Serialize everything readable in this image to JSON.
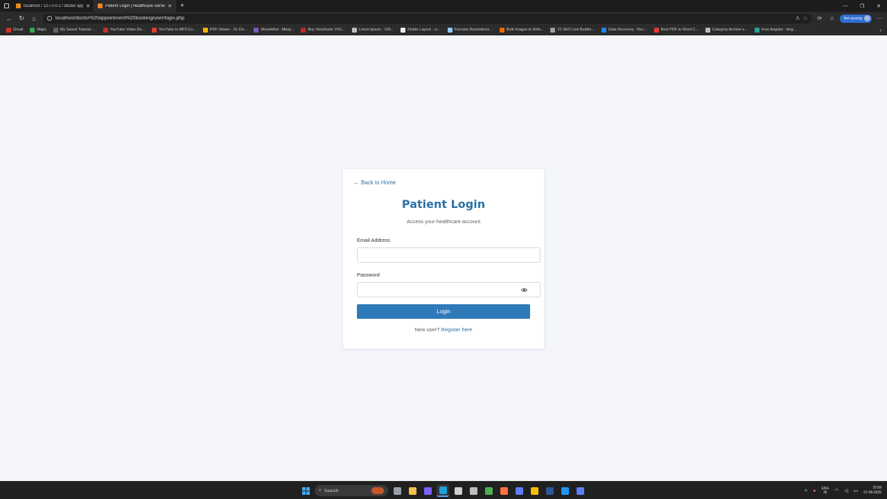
{
  "browser": {
    "tabs": [
      {
        "title": "localhost / 127.0.0.1 / doctor app",
        "favicon_color": "#e58b1f",
        "active": false
      },
      {
        "title": "Patient Login | Healthcare Service",
        "favicon_color": "#e8852a",
        "active": true
      }
    ],
    "new_tab_symbol": "+",
    "url": "localhost/doctor%20appointment%20booking/user/login.php",
    "profile_label": "Not syncing",
    "bookmarks": [
      {
        "label": "Gmail",
        "color": "#d93025"
      },
      {
        "label": "Maps",
        "color": "#34a853"
      },
      {
        "label": "My Saved Tutorial -...",
        "color": "#5f6368"
      },
      {
        "label": "YouTube Video Do...",
        "color": "#c4302b"
      },
      {
        "label": "YouTube to MP3 Co...",
        "color": "#e53935"
      },
      {
        "label": "PDF Viewer - Sc Do...",
        "color": "#f4b400"
      },
      {
        "label": "MovieMod - Mkvp...",
        "color": "#7e57c2"
      },
      {
        "label": "Buy ViewSonic VX2...",
        "color": "#c62828"
      },
      {
        "label": "Lorem Ipsum - 100...",
        "color": "#bdbdbd"
      },
      {
        "label": "Flutter Layout - cr...",
        "color": "#eeeeee"
      },
      {
        "label": "Formats Resolutions...",
        "color": "#90caf9"
      },
      {
        "label": "Bulk Images to Web...",
        "color": "#ef6c00"
      },
      {
        "label": "21 SEO Link Buildin...",
        "color": "#9e9e9e"
      },
      {
        "label": "Data Recovery - Rec...",
        "color": "#1e88e5"
      },
      {
        "label": "Best PDF to Word C...",
        "color": "#e53935"
      },
      {
        "label": "Category Archive s...",
        "color": "#bdbdbd"
      },
      {
        "label": "Free Angular - Ang...",
        "color": "#26a69a"
      }
    ]
  },
  "page": {
    "back_link": "Back to Home",
    "title": "Patient Login",
    "subtitle": "Access your healthcare account",
    "email_label": "Email Address",
    "email_value": "",
    "password_label": "Password",
    "password_value": "",
    "login_button": "Login",
    "register_prompt": "New user?",
    "register_link": "Register here"
  },
  "colors": {
    "accent": "#2f7ab8",
    "title": "#2b72a6",
    "link": "#2d6da3",
    "page_bg": "#f4f6fa"
  },
  "taskbar": {
    "search_placeholder": "Search",
    "apps": [
      {
        "name": "task-view-icon",
        "color": "#9aa0a6"
      },
      {
        "name": "file-explorer-icon",
        "color": "#f2c14e"
      },
      {
        "name": "copilot-icon",
        "color": "#7b61ff"
      },
      {
        "name": "edge-icon",
        "color": "#1fa0d8"
      },
      {
        "name": "store-icon",
        "color": "#d0d0d0"
      },
      {
        "name": "settings-icon",
        "color": "#bdbdbd"
      },
      {
        "name": "xbox-icon",
        "color": "#4caf50"
      },
      {
        "name": "firefox-icon",
        "color": "#ff7043"
      },
      {
        "name": "terminal-icon",
        "color": "#5c7cfa"
      },
      {
        "name": "chrome-icon",
        "color": "#fbbc05"
      },
      {
        "name": "word-icon",
        "color": "#2b5797"
      },
      {
        "name": "vscode-icon",
        "color": "#2196f3"
      },
      {
        "name": "terminal-icon-2",
        "color": "#5c7cfa"
      }
    ],
    "lang_top": "ENG",
    "lang_bottom": "IN",
    "time": "22:58",
    "date": "07-08-2025"
  }
}
